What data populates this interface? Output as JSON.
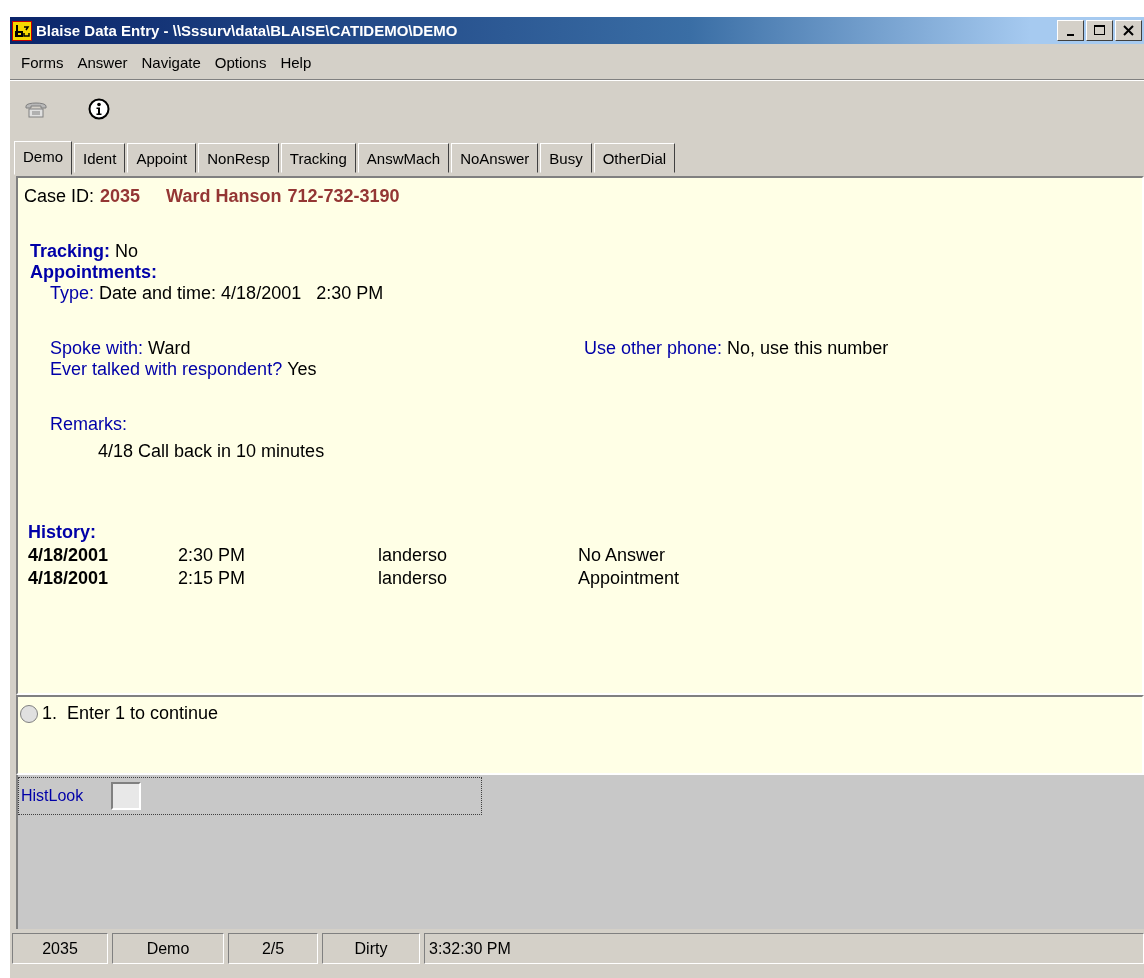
{
  "window": {
    "title": "Blaise Data Entry - \\\\Sssurv\\data\\BLAISE\\CATIDEMO\\DEMO"
  },
  "menu": [
    "Forms",
    "Answer",
    "Navigate",
    "Options",
    "Help"
  ],
  "tabs": [
    {
      "label": "Demo",
      "selected": true
    },
    {
      "label": "Ident",
      "selected": false
    },
    {
      "label": "Appoint",
      "selected": false
    },
    {
      "label": "NonResp",
      "selected": false
    },
    {
      "label": "Tracking",
      "selected": false
    },
    {
      "label": "AnswMach",
      "selected": false
    },
    {
      "label": "NoAnswer",
      "selected": false
    },
    {
      "label": "Busy",
      "selected": false
    },
    {
      "label": "OtherDial",
      "selected": false
    }
  ],
  "form": {
    "case_label": "Case ID:",
    "case_id": "2035",
    "name": "Ward Hanson",
    "phone": "712-732-3190",
    "tracking": {
      "label": "Tracking:",
      "value": "No"
    },
    "appointments": {
      "heading": "Appointments:",
      "type": {
        "label": "Type:",
        "value": "Date and time: 4/18/2001   2:30 PM"
      },
      "spoke_with": {
        "label": "Spoke with:",
        "value": "Ward"
      },
      "other_phone": {
        "label": "Use other phone:",
        "value": "No, use this number"
      },
      "ever_talked": {
        "label": "Ever talked with respondent?",
        "value": "Yes"
      },
      "remarks": {
        "label": "Remarks:",
        "value": "4/18 Call back in 10 minutes"
      }
    },
    "history": {
      "heading": "History:",
      "rows": [
        [
          "4/18/2001",
          "2:30 PM",
          "landerso",
          "No Answer"
        ],
        [
          "4/18/2001",
          "2:15 PM",
          "landerso",
          "Appointment"
        ]
      ]
    }
  },
  "answer": {
    "options": [
      {
        "number": "1.",
        "label": "Enter 1 to continue",
        "selected": false
      }
    ]
  },
  "field_panel": {
    "label": "HistLook"
  },
  "status_bar": [
    "2035",
    "Demo",
    "2/5",
    "Dirty",
    "3:32:30 PM"
  ]
}
